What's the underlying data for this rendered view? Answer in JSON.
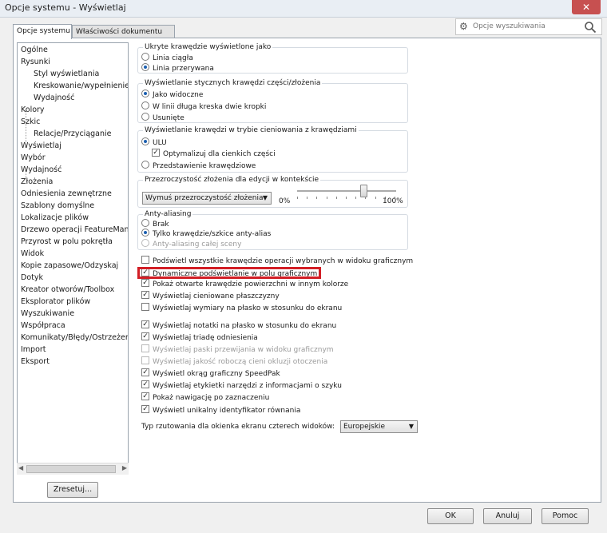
{
  "window": {
    "title": "Opcje systemu - Wyświetlaj",
    "close_label": "✕"
  },
  "tabs": [
    "Opcje systemu",
    "Właściwości dokumentu"
  ],
  "search": {
    "placeholder": "Opcje wyszukiwania"
  },
  "tree": [
    {
      "label": "Ogólne",
      "sub": false
    },
    {
      "label": "Rysunki",
      "sub": false
    },
    {
      "label": "Styl wyświetlania",
      "sub": true
    },
    {
      "label": "Kreskowanie/wypełnienie c",
      "sub": true
    },
    {
      "label": "Wydajność",
      "sub": true
    },
    {
      "label": "Kolory",
      "sub": false
    },
    {
      "label": "Szkic",
      "sub": false
    },
    {
      "label": "Relacje/Przyciąganie",
      "sub": true
    },
    {
      "label": "Wyświetlaj",
      "sub": false
    },
    {
      "label": "Wybór",
      "sub": false
    },
    {
      "label": "Wydajność",
      "sub": false
    },
    {
      "label": "Złożenia",
      "sub": false
    },
    {
      "label": "Odniesienia zewnętrzne",
      "sub": false
    },
    {
      "label": "Szablony domyślne",
      "sub": false
    },
    {
      "label": "Lokalizacje plików",
      "sub": false
    },
    {
      "label": "Drzewo operacji FeatureManag",
      "sub": false
    },
    {
      "label": "Przyrost w polu pokrętła",
      "sub": false
    },
    {
      "label": "Widok",
      "sub": false
    },
    {
      "label": "Kopie zapasowe/Odzyskaj",
      "sub": false
    },
    {
      "label": "Dotyk",
      "sub": false
    },
    {
      "label": "Kreator otworów/Toolbox",
      "sub": false
    },
    {
      "label": "Eksplorator plików",
      "sub": false
    },
    {
      "label": "Wyszukiwanie",
      "sub": false
    },
    {
      "label": "Współpraca",
      "sub": false
    },
    {
      "label": "Komunikaty/Błędy/Ostrzeżenia",
      "sub": false
    },
    {
      "label": "Import",
      "sub": false
    },
    {
      "label": "Eksport",
      "sub": false
    }
  ],
  "reset_button": "Zresetuj...",
  "hidden_edges": {
    "title": "Ukryte krawędzie wyświetlone jako",
    "options": [
      {
        "label": "Linia ciągła",
        "selected": false
      },
      {
        "label": "Linia przerywana",
        "selected": true
      }
    ]
  },
  "tangent_edges": {
    "title": "Wyświetlanie stycznych krawędzi części/złożenia",
    "options": [
      {
        "label": "Jako widoczne",
        "selected": true
      },
      {
        "label": "W linii długa kreska dwie kropki",
        "selected": false
      },
      {
        "label": "Usunięte",
        "selected": false
      }
    ]
  },
  "shaded_edges": {
    "title": "Wyświetlanie krawędzi w trybie cieniowania z krawędziami",
    "ulu": {
      "label": "ULU",
      "selected": true
    },
    "optimize": {
      "label": "Optymalizuj dla cienkich części",
      "checked": true
    },
    "representation": {
      "label": "Przedstawienie krawędziowe",
      "selected": false
    }
  },
  "transparency": {
    "title": "Przezroczystość złożenia dla edycji w kontekście",
    "select_value": "Wymuś przezroczystość złożenia",
    "min_label": "0%",
    "max_label": "100%",
    "level": 0.85
  },
  "antialiasing": {
    "title": "Anty-aliasing",
    "options": [
      {
        "label": "Brak",
        "selected": false,
        "disabled": false
      },
      {
        "label": "Tylko krawędzie/szkice anty-alias",
        "selected": true,
        "disabled": false
      },
      {
        "label": "Anty-aliasing całej sceny",
        "selected": false,
        "disabled": true
      }
    ]
  },
  "checkboxes_a": [
    {
      "label": "Podświetl wszystkie krawędzie operacji wybranych w widoku graficznym",
      "checked": false,
      "disabled": false
    },
    {
      "label": "Dynamiczne podświetlanie w polu graficznym",
      "checked": true,
      "disabled": false
    },
    {
      "label": "Pokaż otwarte krawędzie powierzchni w innym kolorze",
      "checked": true,
      "disabled": false
    },
    {
      "label": "Wyświetlaj cieniowane płaszczyzny",
      "checked": true,
      "disabled": false
    },
    {
      "label": "Wyświetlaj wymiary na płasko w stosunku do ekranu",
      "checked": false,
      "disabled": false
    }
  ],
  "checkboxes_b": [
    {
      "label": "Wyświetlaj notatki na płasko w stosunku do ekranu",
      "checked": true,
      "disabled": false
    },
    {
      "label": "Wyświetlaj triadę odniesienia",
      "checked": true,
      "disabled": false
    },
    {
      "label": "Wyświetlaj paski przewijania w widoku graficznym",
      "checked": false,
      "disabled": true
    },
    {
      "label": "Wyświetlaj jakość roboczą cieni okluzji otoczenia",
      "checked": false,
      "disabled": true
    },
    {
      "label": "Wyświetl okrąg graficzny SpeedPak",
      "checked": true,
      "disabled": false
    },
    {
      "label": "Wyświetlaj etykietki narzędzi z informacjami o szyku",
      "checked": true,
      "disabled": false
    },
    {
      "label": "Pokaż nawigację po zaznaczeniu",
      "checked": true,
      "disabled": false
    },
    {
      "label": "Wyświetl unikalny identyfikator równania",
      "checked": true,
      "disabled": false
    }
  ],
  "projection": {
    "label": "Typ rzutowania dla okienka ekranu czterech widoków:",
    "value": "Europejskie"
  },
  "footer": {
    "ok": "OK",
    "cancel": "Anuluj",
    "help": "Pomoc"
  },
  "accent_color": "#1c5fb0",
  "highlight_color": "#d21f26"
}
